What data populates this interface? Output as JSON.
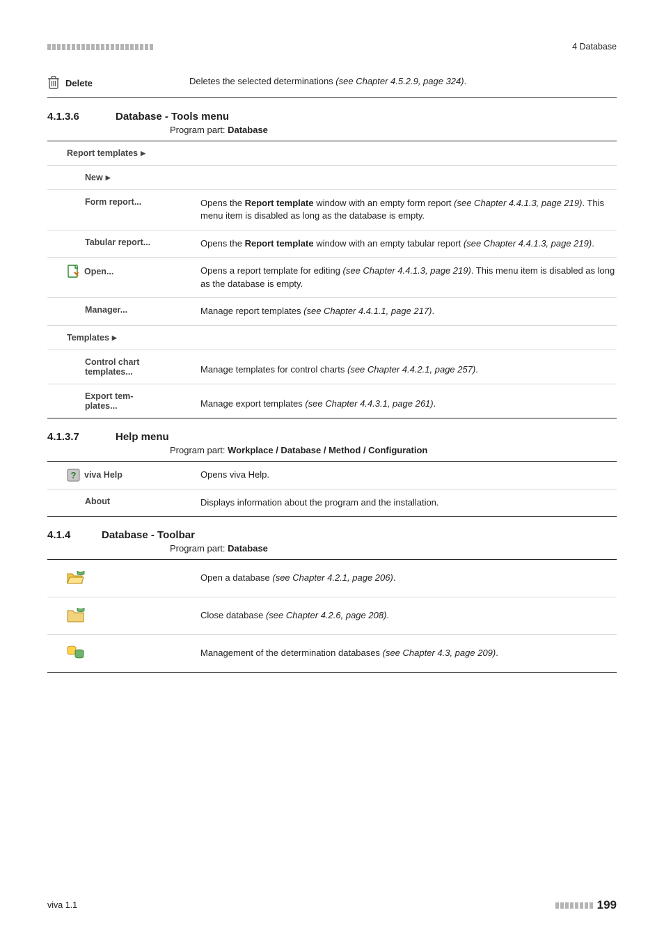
{
  "header": {
    "right": "4 Database"
  },
  "delete": {
    "label": "Delete",
    "desc_pre": "Deletes the selected determinations ",
    "desc_ref": "(see Chapter 4.5.2.9, page 324)",
    "desc_post": "."
  },
  "sec4136": {
    "num": "4.1.3.6",
    "title": "Database - Tools menu",
    "program_part_label": "Program part: ",
    "program_part_value": "Database"
  },
  "tools": {
    "report_templates": "Report templates",
    "new": "New",
    "form_report": {
      "label": "Form report...",
      "d1": "Opens the ",
      "d2": "Report template",
      "d3": " window with an empty form report ",
      "ref": "(see Chapter 4.4.1.3, page 219)",
      "d4": ". This menu item is disabled as long as the database is empty."
    },
    "tabular_report": {
      "label": "Tabular report...",
      "d1": "Opens the ",
      "d2": "Report template",
      "d3": " window with an empty tabular report ",
      "ref": "(see Chapter 4.4.1.3, page 219)",
      "d4": "."
    },
    "open": {
      "label": "Open...",
      "d1": "Opens a report template for editing ",
      "ref": "(see Chapter 4.4.1.3, page 219)",
      "d2": ". This menu item is disabled as long as the database is empty."
    },
    "manager": {
      "label": "Manager...",
      "d1": "Manage report templates ",
      "ref": "(see Chapter 4.4.1.1, page 217)",
      "d2": "."
    },
    "templates": "Templates",
    "control_chart": {
      "label1": "Control chart",
      "label2": "templates...",
      "d1": "Manage templates for control charts ",
      "ref": "(see Chapter 4.4.2.1, page 257)",
      "d2": "."
    },
    "export": {
      "label1": "Export tem-",
      "label2": "plates...",
      "d1": "Manage export templates ",
      "ref": "(see Chapter 4.4.3.1, page 261)",
      "d2": "."
    }
  },
  "sec4137": {
    "num": "4.1.3.7",
    "title": "Help menu",
    "program_part_label": "Program part: ",
    "program_part_value": "Workplace / Database / Method / Configuration"
  },
  "help": {
    "viva": {
      "label": "viva Help",
      "desc": "Opens viva Help."
    },
    "about": {
      "label": "About",
      "desc": "Displays information about the program and the installation."
    }
  },
  "sec414": {
    "num": "4.1.4",
    "title": "Database - Toolbar",
    "program_part_label": "Program part: ",
    "program_part_value": "Database"
  },
  "toolbar": {
    "open": {
      "d1": "Open a database ",
      "ref": "(see Chapter 4.2.1, page 206)",
      "d2": "."
    },
    "close": {
      "d1": "Close database ",
      "ref": "(see Chapter 4.2.6, page 208)",
      "d2": "."
    },
    "manage": {
      "d1": "Management of the determination databases ",
      "ref": "(see Chapter 4.3, page 209)",
      "d2": "."
    }
  },
  "footer": {
    "left": "viva 1.1",
    "page": "199"
  }
}
